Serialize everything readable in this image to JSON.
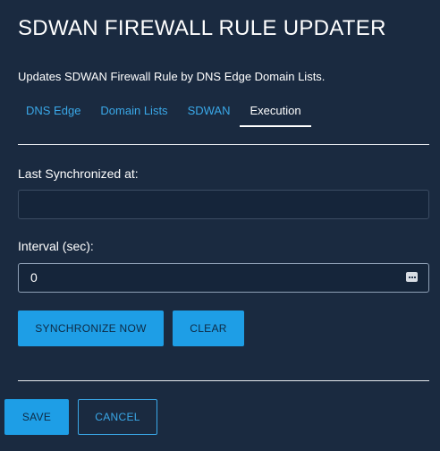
{
  "header": {
    "title": "SDWAN FIREWALL RULE UPDATER",
    "subtitle": "Updates SDWAN Firewall Rule by DNS Edge Domain Lists."
  },
  "tabs": [
    {
      "label": "DNS Edge",
      "active": false
    },
    {
      "label": "Domain Lists",
      "active": false
    },
    {
      "label": "SDWAN",
      "active": false
    },
    {
      "label": "Execution",
      "active": true
    }
  ],
  "form": {
    "last_sync_label": "Last Synchronized at:",
    "last_sync_value": "",
    "interval_label": "Interval (sec):",
    "interval_value": "0"
  },
  "actions": {
    "synchronize_label": "SYNCHRONIZE NOW",
    "clear_label": "CLEAR"
  },
  "footer": {
    "save_label": "SAVE",
    "cancel_label": "CANCEL"
  },
  "colors": {
    "background": "#1a2a40",
    "accent": "#1e9ee6",
    "tab_link": "#3aa8e8"
  }
}
